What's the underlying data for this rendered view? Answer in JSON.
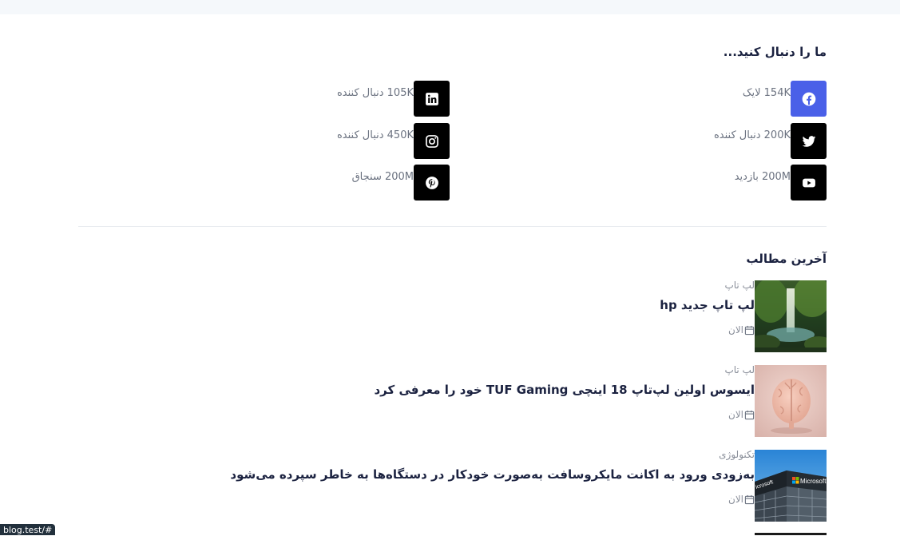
{
  "follow": {
    "title": "ما را دنبال کنید...",
    "items": [
      {
        "key": "facebook",
        "text": "154K لایک",
        "color": "#4a60e8",
        "icon": "facebook-icon"
      },
      {
        "key": "linkedin",
        "text": "105K دنبال کننده",
        "color": "#000000",
        "icon": "linkedin-icon"
      },
      {
        "key": "twitter",
        "text": "200K دنبال کننده",
        "color": "#000000",
        "icon": "twitter-icon"
      },
      {
        "key": "instagram",
        "text": "450K دنبال کننده",
        "color": "#000000",
        "icon": "instagram-icon"
      },
      {
        "key": "youtube",
        "text": "200M بازدید",
        "color": "#000000",
        "icon": "youtube-icon"
      },
      {
        "key": "pinterest",
        "text": "200M سنجاق",
        "color": "#000000",
        "icon": "pinterest-icon"
      }
    ]
  },
  "latest": {
    "title": "آخرین مطالب",
    "posts": [
      {
        "category": "لپ تاپ",
        "title": "لپ تاپ جدید hp",
        "date": "الان",
        "thumb": "waterfall-forest-image"
      },
      {
        "category": "لپ تاپ",
        "title": "ایسوس اولین لپ‌تاپ 18 اینچی TUF Gaming خود را معرفی کرد",
        "date": "الان",
        "thumb": "brain-model-image"
      },
      {
        "category": "تکنولوژی",
        "title": "به‌زودی ورود به اکانت مایکروسافت به‌صورت خودکار در دستگاه‌ها به خاطر سپرده می‌شود",
        "date": "الان",
        "thumb": "microsoft-building-image"
      }
    ]
  },
  "thumb_text": {
    "ms_left": "icrosoft",
    "ms_right": "Microsoft"
  },
  "statusbar": {
    "url": "blog.test/#"
  }
}
